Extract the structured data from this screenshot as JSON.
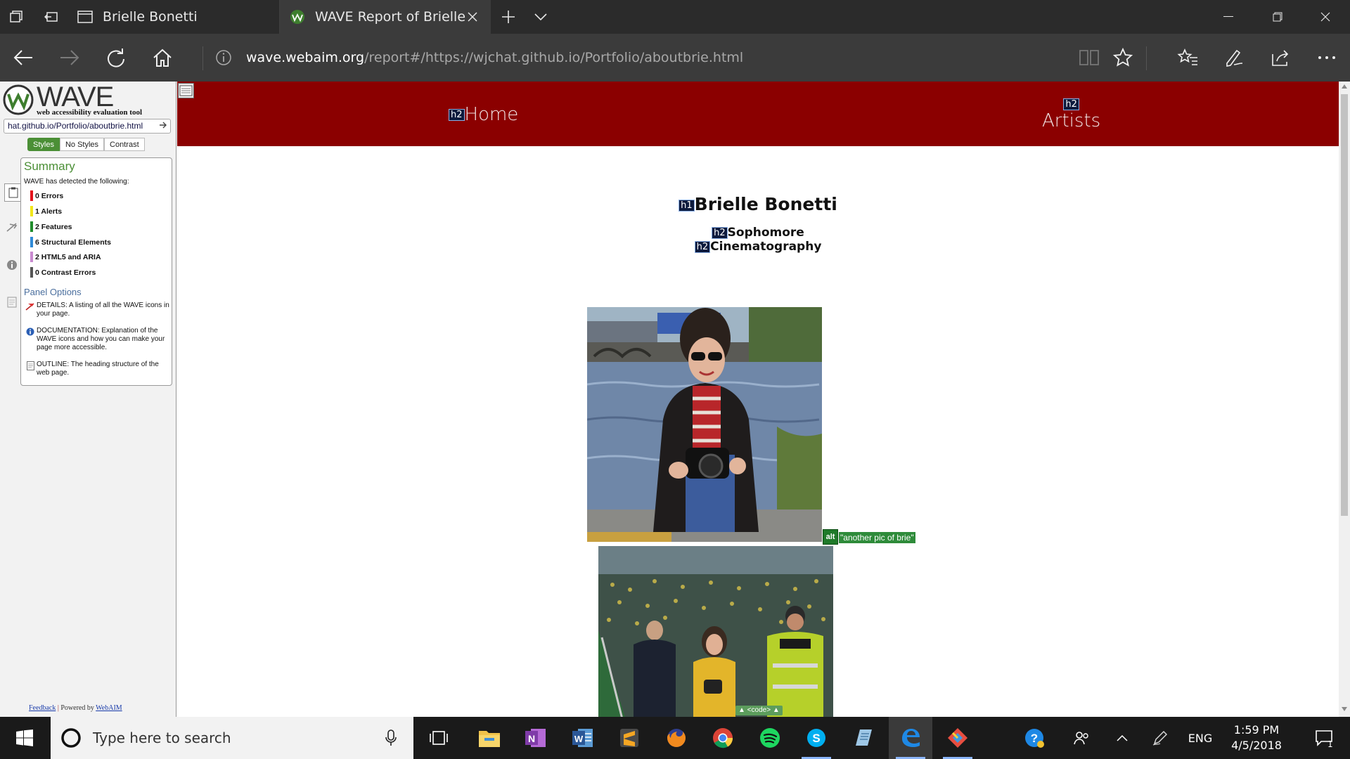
{
  "browser": {
    "tabs": [
      {
        "label": "Brielle Bonetti",
        "active": false
      },
      {
        "label": "WAVE Report of Brielle",
        "active": true
      }
    ],
    "url_host": "wave.webaim.org",
    "url_path": "/report#/https://wjchat.github.io/Portfolio/aboutbrie.html"
  },
  "wave": {
    "logo": "WAVE",
    "tagline": "web accessibility evaluation tool",
    "url_field": "hat.github.io/Portfolio/aboutbrie.html",
    "view_tabs": [
      "Styles",
      "No Styles",
      "Contrast"
    ],
    "summary": {
      "title": "Summary",
      "intro": "WAVE has detected the following:",
      "items": [
        {
          "label": "0 Errors",
          "color": "#e3121b"
        },
        {
          "label": "1 Alerts",
          "color": "#f2e61a"
        },
        {
          "label": "2 Features",
          "color": "#1f8c2b"
        },
        {
          "label": "6 Structural Elements",
          "color": "#2f8ad6"
        },
        {
          "label": "2 HTML5 and ARIA",
          "color": "#c98ad0"
        },
        {
          "label": "0 Contrast Errors",
          "color": "#555555"
        }
      ]
    },
    "panel_options": {
      "title": "Panel Options",
      "details": "DETAILS: A listing of all the WAVE icons in your page.",
      "documentation": "DOCUMENTATION: Explanation of the WAVE icons and how you can make your page more accessible.",
      "outline": "OUTLINE: The heading structure of the web page."
    },
    "footer": {
      "feedback": "Feedback",
      "powered": "Powered by",
      "webaim": "WebAIM"
    }
  },
  "page": {
    "nav": {
      "home": "Home",
      "artists": "Artists"
    },
    "h1": "Brielle Bonetti",
    "h2_year": "Sophomore",
    "h2_major": "Cinematography",
    "badges": {
      "h1": "h1",
      "h2": "h2",
      "alt": "alt",
      "code": "▲ <code> ▲"
    },
    "alt_text": "\"another pic of brie\""
  },
  "taskbar": {
    "search_placeholder": "Type here to search",
    "language": "ENG",
    "time": "1:59 PM",
    "date": "4/5/2018",
    "notification_count": "1"
  }
}
